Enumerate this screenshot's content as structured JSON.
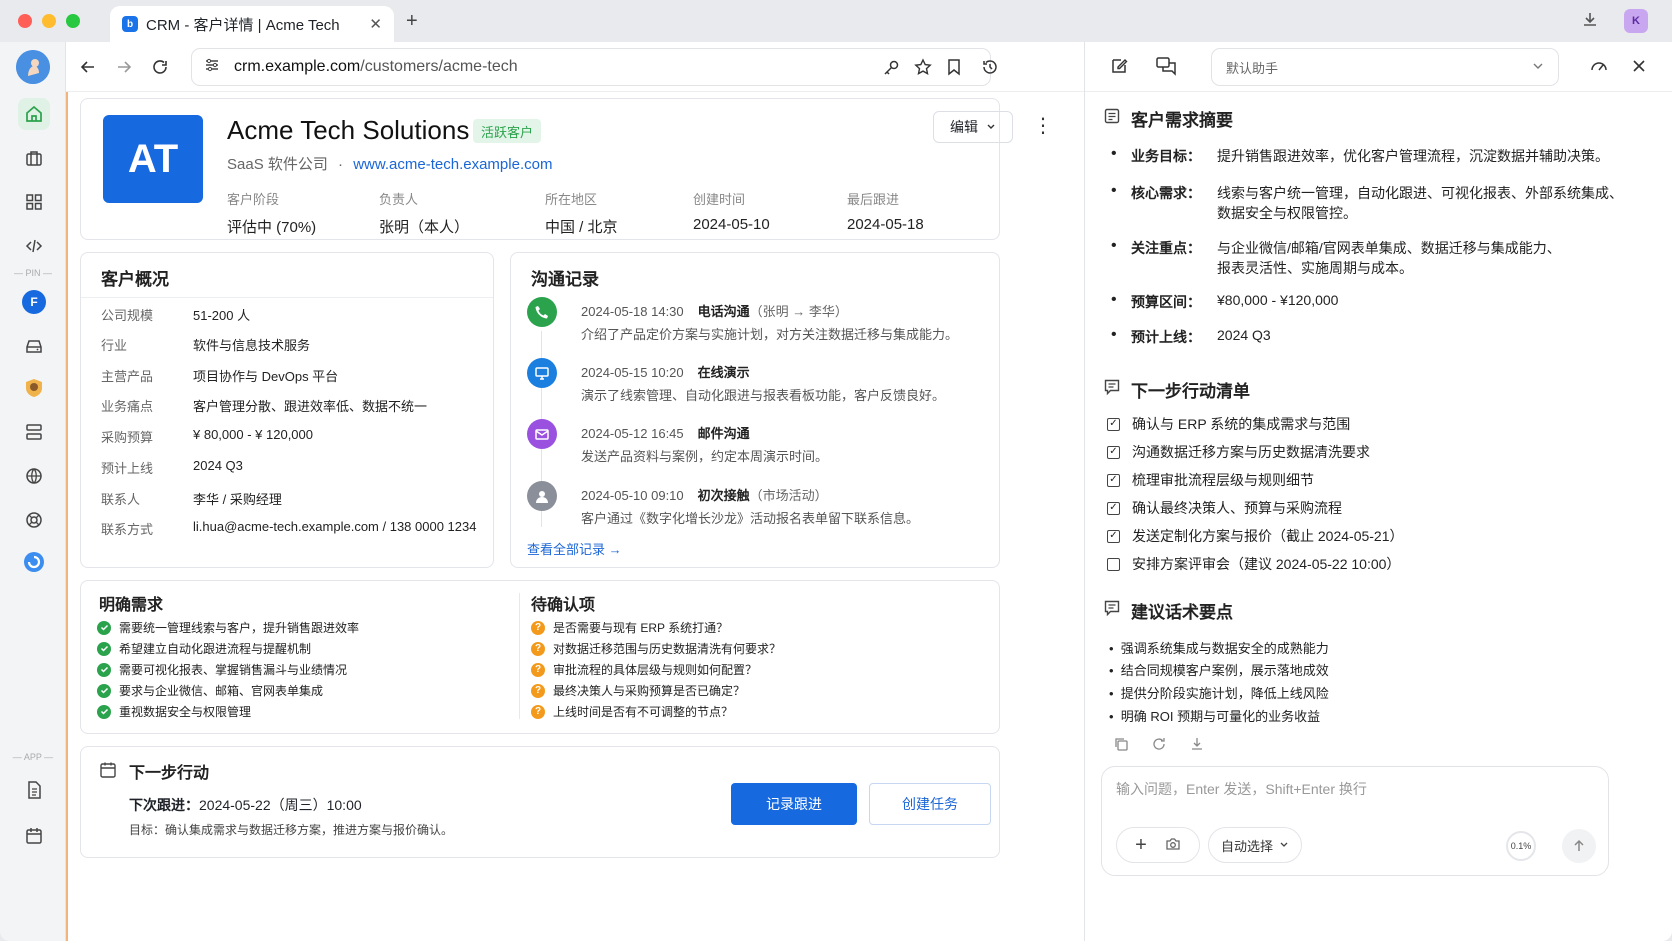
{
  "browser": {
    "tab_title": "CRM - 客户详情 | Acme Tech",
    "tab_favicon": "b",
    "url_domain": "crm.example.com",
    "url_path": "/customers/acme-tech",
    "extension_label": "K"
  },
  "rail": {
    "pin_label": "PIN",
    "app_label": "APP",
    "f_label": "F"
  },
  "customer": {
    "initials": "AT",
    "name": "Acme Tech Solutions",
    "badge": "活跃客户",
    "type": "SaaS 软件公司",
    "separator": "·",
    "website": "www.acme-tech.example.com",
    "edit_label": "编辑",
    "meta": [
      {
        "label": "客户阶段",
        "value": "评估中 (70%)"
      },
      {
        "label": "负责人",
        "value": "张明（本人）"
      },
      {
        "label": "所在地区",
        "value": "中国 / 北京"
      },
      {
        "label": "创建时间",
        "value": "2024-05-10"
      },
      {
        "label": "最后跟进",
        "value": "2024-05-18"
      }
    ]
  },
  "overview": {
    "title": "客户概况",
    "rows": [
      {
        "k": "公司规模",
        "v": "51-200 人"
      },
      {
        "k": "行业",
        "v": "软件与信息技术服务"
      },
      {
        "k": "主营产品",
        "v": "项目协作与 DevOps 平台"
      },
      {
        "k": "业务痛点",
        "v": "客户管理分散、跟进效率低、数据不统一"
      },
      {
        "k": "采购预算",
        "v": "¥ 80,000 - ¥ 120,000"
      },
      {
        "k": "预计上线",
        "v": "2024 Q3"
      },
      {
        "k": "联系人",
        "v": "李华 / 采购经理"
      },
      {
        "k": "联系方式",
        "v": "li.hua@acme-tech.example.com / 138 0000 1234"
      }
    ]
  },
  "comms": {
    "title": "沟通记录",
    "records": [
      {
        "time": "2024-05-18 14:30",
        "type": "电话沟通",
        "sub": "（张明 → 李华）",
        "desc": "介绍了产品定价方案与实施计划，对方关注数据迁移与集成能力。",
        "icon": "phone-icon",
        "color": "#2ba24c"
      },
      {
        "time": "2024-05-15 10:20",
        "type": "在线演示",
        "sub": "",
        "desc": "演示了线索管理、自动化跟进与报表看板功能，客户反馈良好。",
        "icon": "monitor-icon",
        "color": "#1b7fe0"
      },
      {
        "time": "2024-05-12 16:45",
        "type": "邮件沟通",
        "sub": "",
        "desc": "发送产品资料与案例，约定本周演示时间。",
        "icon": "mail-icon",
        "color": "#9b51e0"
      },
      {
        "time": "2024-05-10 09:10",
        "type": "初次接触",
        "sub": "（市场活动）",
        "desc": "客户通过《数字化增长沙龙》活动报名表单留下联系信息。",
        "icon": "user-icon",
        "color": "#8a8f99"
      }
    ],
    "view_all": "查看全部记录 →"
  },
  "needs": {
    "title": "明确需求",
    "items": [
      "需要统一管理线索与客户，提升销售跟进效率",
      "希望建立自动化跟进流程与提醒机制",
      "需要可视化报表、掌握销售漏斗与业绩情况",
      "要求与企业微信、邮箱、官网表单集成",
      "重视数据安全与权限管理"
    ]
  },
  "pending": {
    "title": "待确认项",
    "items": [
      "是否需要与现有 ERP 系统打通？",
      "对数据迁移范围与历史数据清洗有何要求？",
      "审批流程的具体层级与规则如何配置？",
      "最终决策人与采购预算是否已确定？",
      "上线时间是否有不可调整的节点？"
    ]
  },
  "next_action": {
    "title": "下一步行动",
    "followup_label": "下次跟进：",
    "followup_value": "2024-05-22（周三）10:00",
    "goal": "目标：确认集成需求与数据迁移方案，推进方案与报价确认。",
    "record_btn": "记录跟进",
    "task_btn": "创建任务"
  },
  "assistant": {
    "selector": "默认助手",
    "summary_title": "客户需求摘要",
    "summary": [
      {
        "k": "业务目标：",
        "v": [
          "提升销售跟进效率，优化客户管理流程，沉淀数据并辅助决策。"
        ]
      },
      {
        "k": "核心需求：",
        "v": [
          "线索与客户统一管理，自动化跟进、可视化报表、外部系统集成、",
          "数据安全与权限管控。"
        ]
      },
      {
        "k": "关注重点：",
        "v": [
          "与企业微信/邮箱/官网表单集成、数据迁移与集成能力、",
          "报表灵活性、实施周期与成本。"
        ]
      },
      {
        "k": "预算区间：",
        "v": [
          "¥80,000 - ¥120,000"
        ]
      },
      {
        "k": "预计上线：",
        "v": [
          "2024 Q3"
        ]
      }
    ],
    "actions_title": "下一步行动清单",
    "actions": [
      {
        "text": "确认与 ERP 系统的集成需求与范围",
        "checked": true
      },
      {
        "text": "沟通数据迁移方案与历史数据清洗要求",
        "checked": true
      },
      {
        "text": "梳理审批流程层级与规则细节",
        "checked": true
      },
      {
        "text": "确认最终决策人、预算与采购流程",
        "checked": true
      },
      {
        "text": "发送定制化方案与报价（截止 2024-05-21）",
        "checked": true
      },
      {
        "text": "安排方案评审会（建议 2024-05-22 10:00）",
        "checked": false
      }
    ],
    "talk_title": "建议话术要点",
    "talk": [
      "强调系统集成与数据安全的成熟能力",
      "结合同规模客户案例，展示落地成效",
      "提供分阶段实施计划，降低上线风险",
      "明确 ROI 预期与可量化的业务收益"
    ],
    "input_placeholder": "输入问题，Enter 发送，Shift+Enter 换行",
    "mode": "自动选择",
    "usage": "0.1%"
  }
}
